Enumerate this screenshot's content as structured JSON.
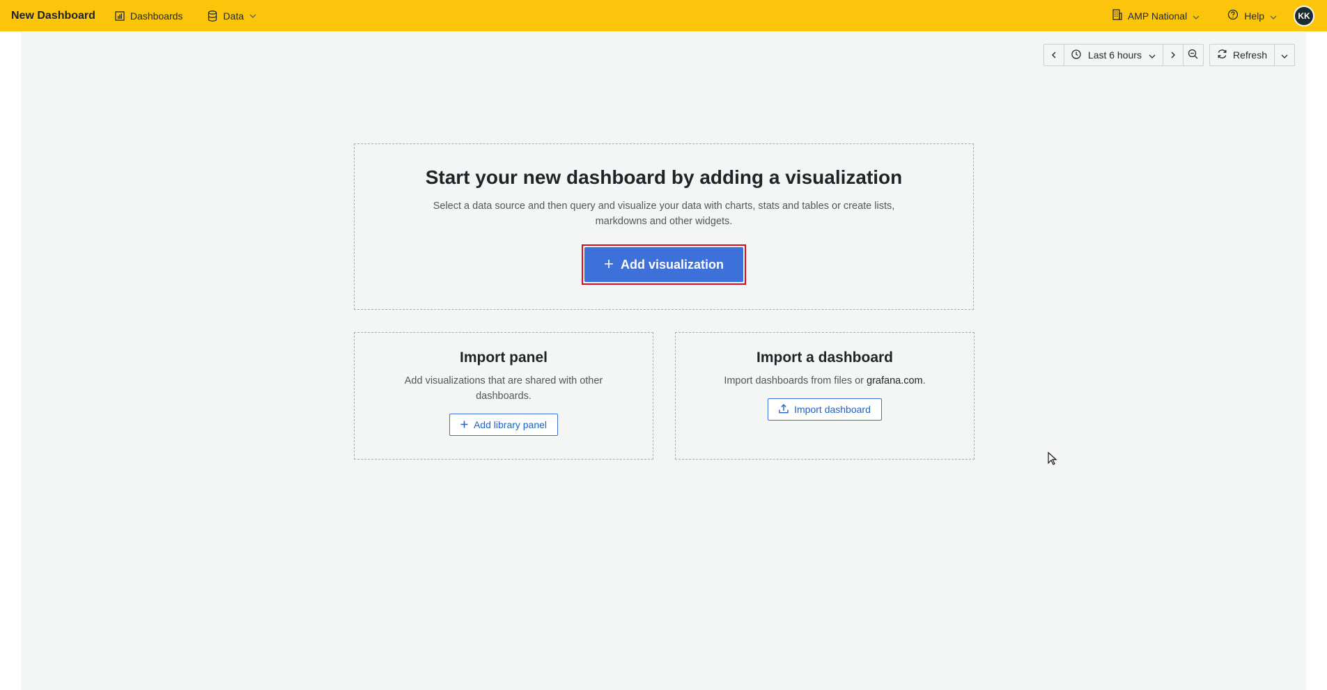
{
  "topbar": {
    "brand": "New Dashboard",
    "nav": [
      {
        "label": "Dashboards",
        "icon": "bar-chart-icon"
      },
      {
        "label": "Data",
        "icon": "database-icon"
      }
    ],
    "org_label": "AMP National",
    "help_label": "Help",
    "avatar_initials": "KK",
    "background_color": "#fdc40c"
  },
  "toolbar": {
    "time_range": "Last 6 hours",
    "refresh_label": "Refresh"
  },
  "main": {
    "title": "Start your new dashboard by adding a visualization",
    "description": "Select a data source and then query and visualize your data with charts, stats and tables or create lists, markdowns and other widgets.",
    "add_visualization_label": "Add visualization",
    "button_color": "#3d71d9",
    "highlight_color": "#e0071b"
  },
  "import_panel": {
    "title": "Import panel",
    "description": "Add visualizations that are shared with other dashboards.",
    "button_label": "Add library panel"
  },
  "import_dashboard": {
    "title": "Import a dashboard",
    "description_prefix": "Import dashboards from files or ",
    "link_text": "grafana.com",
    "description_suffix": ".",
    "button_label": "Import dashboard"
  }
}
